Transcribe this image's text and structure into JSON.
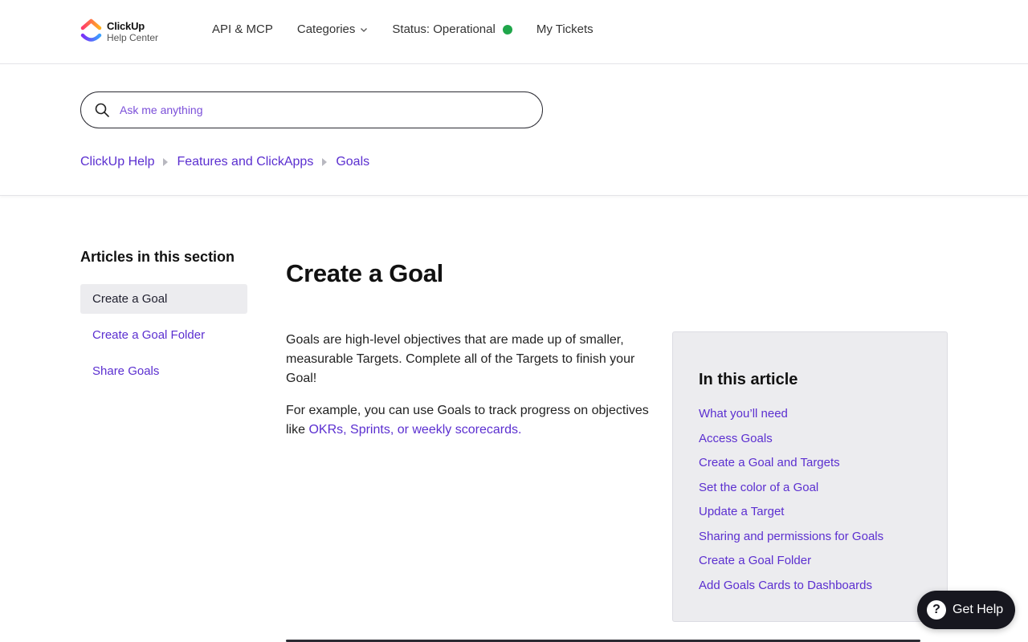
{
  "header": {
    "logo": {
      "brand": "ClickUp",
      "sub": "Help Center",
      "icon": "clickup-logo-icon"
    },
    "nav": {
      "api": "API & MCP",
      "categories": "Categories",
      "status": "Status: Operational",
      "status_color": "#1fa64a",
      "tickets": "My Tickets"
    }
  },
  "search": {
    "placeholder": "Ask me anything",
    "icon": "search-icon"
  },
  "breadcrumb": [
    "ClickUp Help",
    "Features and ClickApps",
    "Goals"
  ],
  "sidebar": {
    "title": "Articles in this section",
    "items": [
      {
        "label": "Create a Goal",
        "active": true
      },
      {
        "label": "Create a Goal Folder",
        "active": false
      },
      {
        "label": "Share Goals",
        "active": false
      }
    ]
  },
  "article": {
    "title": "Create a Goal",
    "paragraph1": "Goals are high-level objectives that are made up of smaller, measurable Targets. Complete all of the Targets to finish your Goal!",
    "paragraph2_prefix": "For example, you can use Goals to track progress on objectives like ",
    "paragraph2_link": "OKRs, Sprints, or weekly scorecards."
  },
  "toc": {
    "title": "In this article",
    "items": [
      "What you’ll need",
      "Access Goals",
      "Create a Goal and Targets",
      "Set the color of a Goal",
      "Update a Target",
      "Sharing and permissions for Goals",
      "Create a Goal Folder",
      "Add Goals Cards to Dashboards"
    ]
  },
  "help": {
    "label": "Get Help",
    "icon_glyph": "?"
  },
  "colors": {
    "accent": "#5b2fd0",
    "dark": "#17171f"
  }
}
